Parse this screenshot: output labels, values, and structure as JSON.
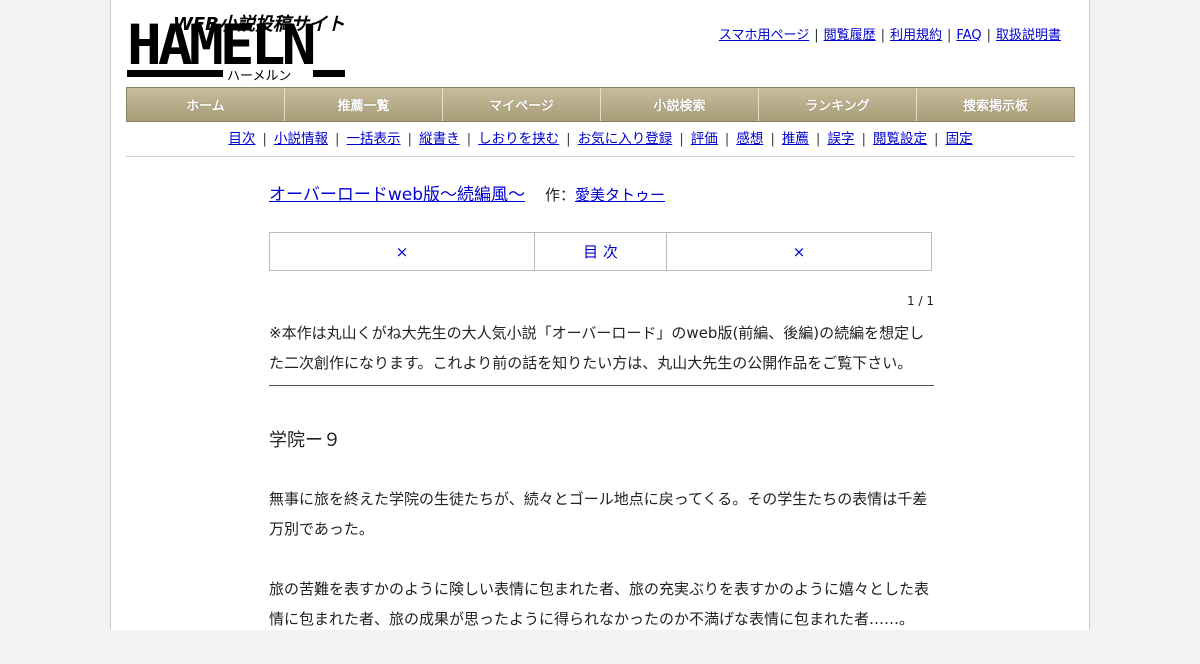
{
  "logo": {
    "tagline": "WEB小説投稿サイト",
    "name": "HAMELN",
    "kana": "ハーメルン"
  },
  "toplinks": [
    "スマホ用ページ",
    "閲覧履歴",
    "利用規約",
    "FAQ",
    "取扱説明書"
  ],
  "menu": [
    "ホーム",
    "推薦一覧",
    "マイページ",
    "小説検索",
    "ランキング",
    "捜索掲示板"
  ],
  "subnav": [
    "目次",
    "小説情報",
    "一括表示",
    "縦書き",
    "しおりを挟む",
    "お気に入り登録",
    "評価",
    "感想",
    "推薦",
    "誤字",
    "閲覧設定",
    "固定"
  ],
  "novel": {
    "title": "オーバーロードweb版〜続編風〜",
    "author_label": "作：",
    "author": "愛美タトゥー"
  },
  "pager": {
    "prev": "×",
    "toc": "目 次",
    "next": "×"
  },
  "page_indicator": "1 / 1",
  "preface": "※本作は丸山くがね大先生の大人気小説「オーバーロード」のweb版(前編、後編)の続編を想定した二次創作になります。これより前の話を知りたい方は、丸山大先生の公開作品をご覧下さい。",
  "chapter_title": "学院ー９",
  "paragraphs": [
    "無事に旅を終えた学院の生徒たちが、続々とゴール地点に戻ってくる。その学生たちの表情は千差万別であった。",
    "旅の苦難を表すかのように険しい表情に包まれた者、旅の充実ぶりを表すかのように嬉々とした表情に包まれた者、旅の成果が思ったように得られなかったのか不満げな表情に包まれた者……。"
  ]
}
